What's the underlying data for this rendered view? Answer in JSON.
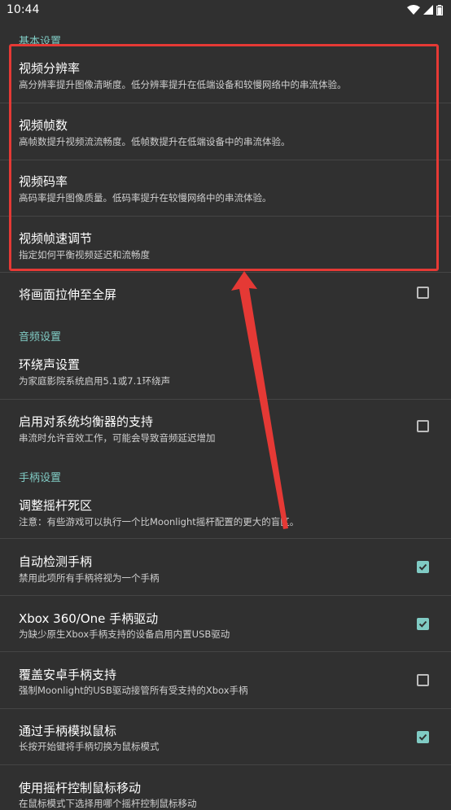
{
  "status_bar": {
    "time": "10:44",
    "icons": [
      "wifi-icon",
      "signal-icon",
      "battery-icon"
    ]
  },
  "sections": {
    "basic": "基本设置",
    "audio": "音频设置",
    "gamepad": "手柄设置"
  },
  "items": {
    "resolution": {
      "title": "视频分辨率",
      "summary": "高分辨率提升图像清晰度。低分辨率提升在低端设备和较慢网络中的串流体验。"
    },
    "fps": {
      "title": "视频帧数",
      "summary": "高帧数提升视频流流畅度。低帧数提升在低端设备中的串流体验。"
    },
    "bitrate": {
      "title": "视频码率",
      "summary": "高码率提升图像质量。低码率提升在较慢网络中的串流体验。"
    },
    "frame_pacing": {
      "title": "视频帧速调节",
      "summary": "指定如何平衡视频延迟和流畅度"
    },
    "stretch": {
      "title": "将画面拉伸至全屏",
      "checked": false
    },
    "surround": {
      "title": "环绕声设置",
      "summary": "为家庭影院系统启用5.1或7.1环绕声"
    },
    "equalizer": {
      "title": "启用对系统均衡器的支持",
      "summary": "串流时允许音效工作，可能会导致音频延迟增加",
      "checked": false
    },
    "deadzone": {
      "title": "调整摇杆死区",
      "summary": "注意：有些游戏可以执行一个比Moonlight摇杆配置的更大的盲区。"
    },
    "auto_detect": {
      "title": "自动检测手柄",
      "summary": "禁用此项所有手柄将视为一个手柄",
      "checked": true
    },
    "xbox_driver": {
      "title": "Xbox 360/One 手柄驱动",
      "summary": "为缺少原生Xbox手柄支持的设备启用内置USB驱动",
      "checked": true
    },
    "override_android": {
      "title": "覆盖安卓手柄支持",
      "summary": "强制Moonlight的USB驱动接管所有受支持的Xbox手柄",
      "checked": false
    },
    "mouse_emulation": {
      "title": "通过手柄模拟鼠标",
      "summary": "长按开始键将手柄切换为鼠标模式",
      "checked": true
    },
    "stick_mouse": {
      "title": "使用摇杆控制鼠标移动",
      "summary": "在鼠标模式下选择用哪个摇杆控制鼠标移动"
    }
  },
  "colors": {
    "background": "#303030",
    "accent": "#80cbc4",
    "annotation": "#e53935"
  }
}
